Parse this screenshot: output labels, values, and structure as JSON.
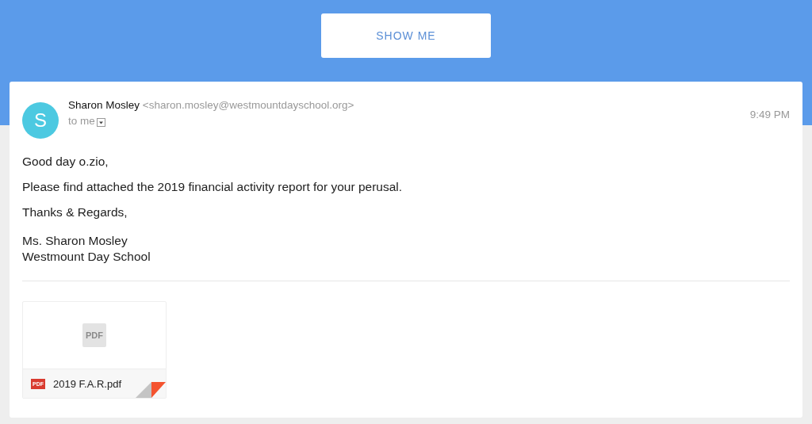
{
  "cta_button": {
    "label": "SHOW ME"
  },
  "email": {
    "avatar_letter": "S",
    "sender_name": "Sharon Mosley",
    "sender_address": "<sharon.mosley@westmountdayschool.org>",
    "recipient": "to me",
    "time": "9:49 PM",
    "body": [
      "Good day o.zio,",
      "Please find attached the 2019 financial activity report for your perusal.",
      "Thanks & Regards,"
    ],
    "signature": [
      "Ms. Sharon Mosley",
      "Westmount Day School"
    ],
    "attachments": [
      {
        "preview_label": "PDF",
        "type_label": "PDF",
        "file_name": "2019 F.A.R.pdf"
      }
    ]
  }
}
